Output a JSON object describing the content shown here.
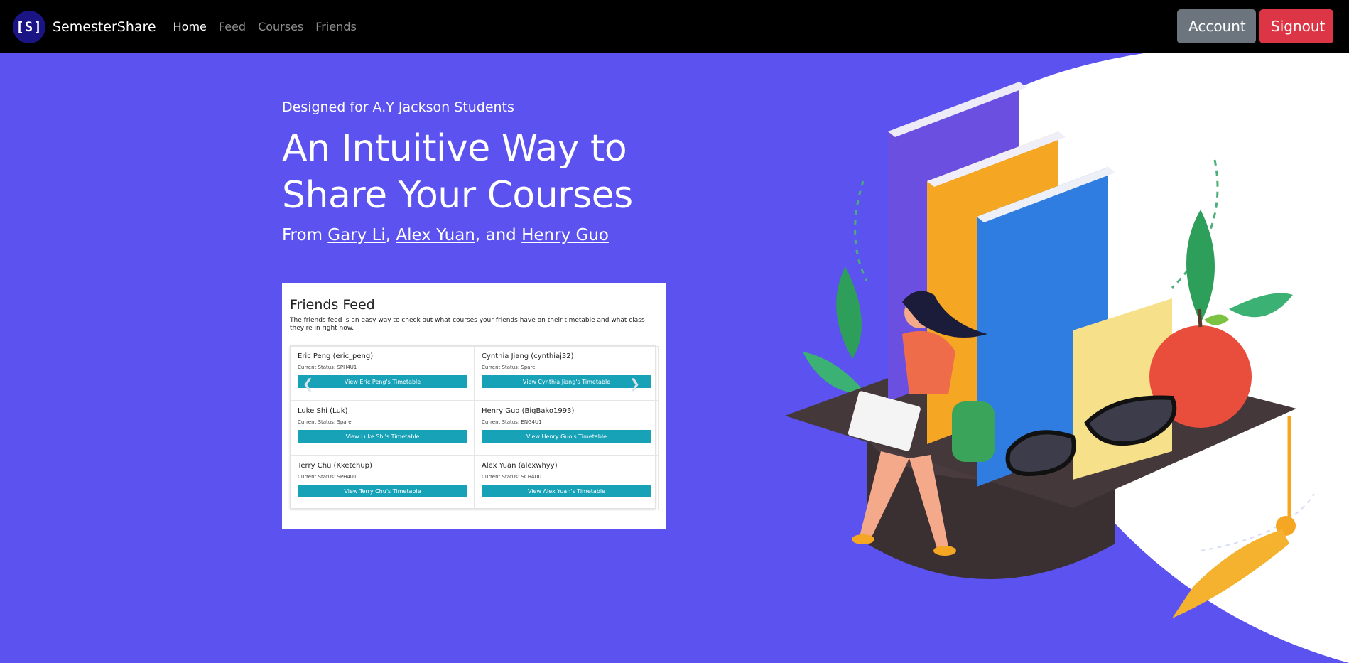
{
  "nav": {
    "logo_text": "[S]",
    "brand": "SemesterShare",
    "links": [
      {
        "label": "Home",
        "active": true
      },
      {
        "label": "Feed",
        "active": false
      },
      {
        "label": "Courses",
        "active": false
      },
      {
        "label": "Friends",
        "active": false
      }
    ],
    "account_label": "Account",
    "signout_label": "Signout"
  },
  "hero": {
    "tagline": "Designed for A.Y Jackson Students",
    "headline_line1": "An Intuitive Way to",
    "headline_line2": "Share Your Courses",
    "credits_prefix": "From ",
    "author1": "Gary Li",
    "sep1": ", ",
    "author2": "Alex Yuan",
    "sep2": ", and ",
    "author3": "Henry Guo"
  },
  "preview": {
    "title": "Friends Feed",
    "description": "The friends feed is an easy way to check out what courses your friends have on their timetable and what class they're in right now.",
    "friends": [
      {
        "name": "Eric Peng (eric_peng)",
        "status": "Current Status: SPH4U1",
        "button": "View Eric Peng's Timetable"
      },
      {
        "name": "Cynthia Jiang (cynthiaj32)",
        "status": "Current Status: Spare",
        "button": "View Cynthia Jiang's Timetable"
      },
      {
        "name": "Luke Shi (Luk)",
        "status": "Current Status: Spare",
        "button": "View Luke Shi's Timetable"
      },
      {
        "name": "Henry Guo (BigBako1993)",
        "status": "Current Status: ENG4U1",
        "button": "View Henry Guo's Timetable"
      },
      {
        "name": "Terry Chu (Kketchup)",
        "status": "Current Status: SPH4U1",
        "button": "View Terry Chu's Timetable"
      },
      {
        "name": "Alex Yuan (alexwhyy)",
        "status": "Current Status: SCH4U0",
        "button": "View Alex Yuan's Timetable"
      }
    ]
  },
  "colors": {
    "hero_bg": "#5b52ef",
    "navbar_bg": "#000000",
    "account_btn": "#6c757d",
    "signout_btn": "#dc3545",
    "feed_btn": "#17a2b8"
  },
  "illustration": {
    "subject": "student-with-laptop-books-graduation-cap-illustration"
  }
}
